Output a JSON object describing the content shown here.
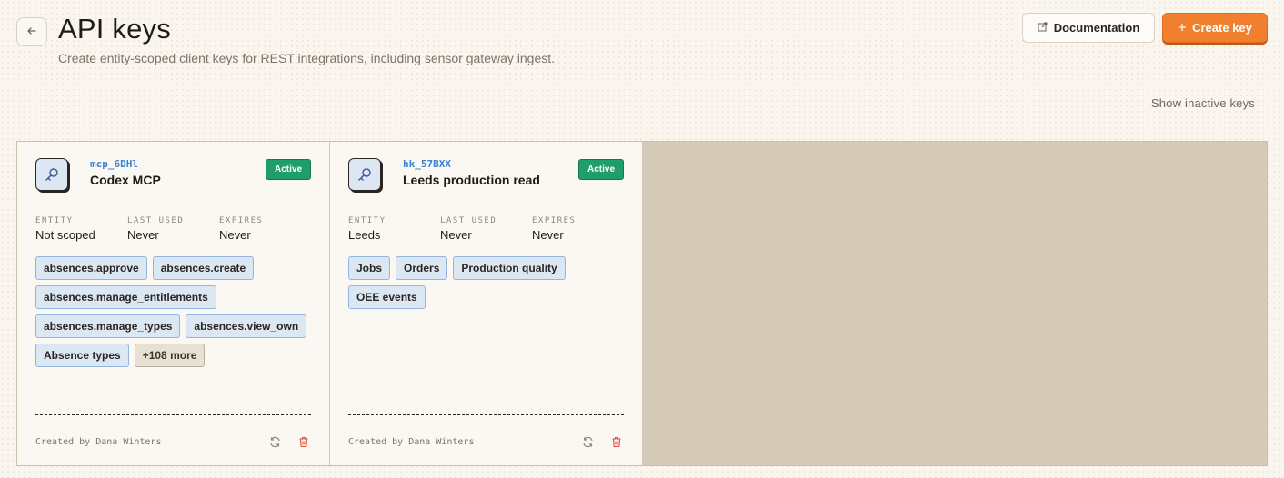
{
  "header": {
    "back_icon": "arrow-left-icon",
    "title": "API keys",
    "subtitle": "Create entity-scoped client keys for REST integrations, including sensor gateway ingest.",
    "documentation_label": "Documentation",
    "create_label": "Create key"
  },
  "filters": {
    "show_inactive_label": "Show inactive keys"
  },
  "colors": {
    "accent": "#f07f2e",
    "active_badge": "#1f9d6b",
    "prefix_text": "#3b82d6",
    "tag_bg": "#dce7f4"
  },
  "cards": [
    {
      "prefix": "mcp_6DHl",
      "name": "Codex MCP",
      "status": "Active",
      "meta": [
        {
          "label": "ENTITY",
          "value": "Not scoped"
        },
        {
          "label": "LAST USED",
          "value": "Never"
        },
        {
          "label": "EXPIRES",
          "value": "Never"
        }
      ],
      "scopes": [
        "absences.approve",
        "absences.create",
        "absences.manage_entitlements",
        "absences.manage_types",
        "absences.view_own",
        "Absence types"
      ],
      "more_label": "+108 more",
      "created_by": "Created by Dana Winters"
    },
    {
      "prefix": "hk_57BXX",
      "name": "Leeds production read",
      "status": "Active",
      "meta": [
        {
          "label": "ENTITY",
          "value": "Leeds"
        },
        {
          "label": "LAST USED",
          "value": "Never"
        },
        {
          "label": "EXPIRES",
          "value": "Never"
        }
      ],
      "scopes": [
        "Jobs",
        "Orders",
        "Production quality",
        "OEE events"
      ],
      "more_label": "",
      "created_by": "Created by Dana Winters"
    }
  ]
}
